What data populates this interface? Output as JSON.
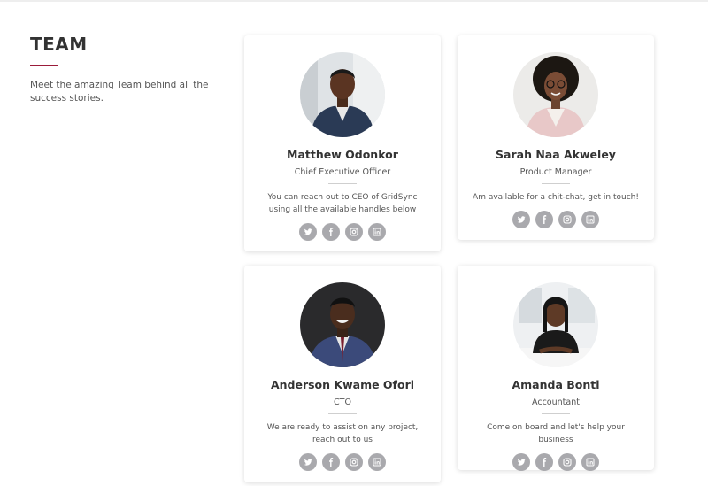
{
  "team": {
    "title": "TEAM",
    "description": "Meet the amazing Team behind all the success stories."
  },
  "members": [
    {
      "name": "Matthew Odonkor",
      "role": "Chief Executive Officer",
      "bio": "You can reach out to CEO of GridSync using all the available handles below"
    },
    {
      "name": "Sarah Naa Akweley",
      "role": "Product Manager",
      "bio": "Am available for a chit-chat, get in touch!"
    },
    {
      "name": "Anderson Kwame Ofori",
      "role": "CTO",
      "bio": "We are ready to assist on any project, reach out to us"
    },
    {
      "name": "Amanda Bonti",
      "role": "Accountant",
      "bio": "Come on board and let's help your business"
    }
  ],
  "social_icons": [
    "twitter-icon",
    "facebook-icon",
    "instagram-icon",
    "linkedin-icon"
  ],
  "colors": {
    "accent": "#9b1c3a",
    "social_bg": "#a9a9ad",
    "heading": "#333333",
    "body_text": "#555555"
  }
}
